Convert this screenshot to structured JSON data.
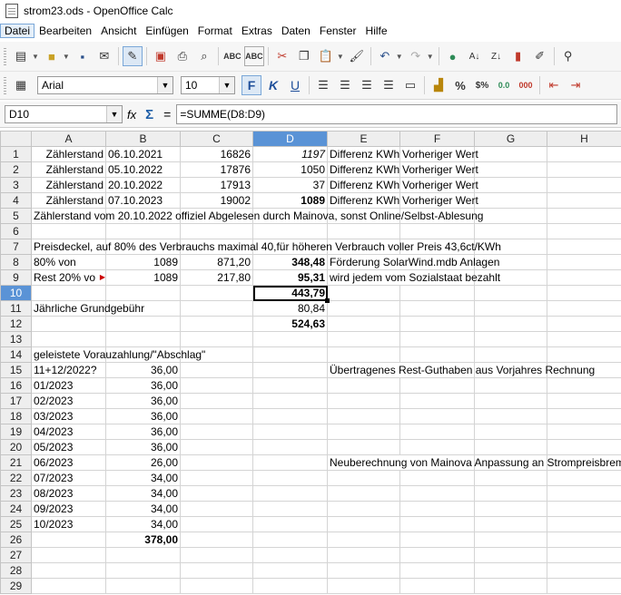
{
  "window": {
    "title": "strom23.ods - OpenOffice Calc"
  },
  "menu": [
    "Datei",
    "Bearbeiten",
    "Ansicht",
    "Einfügen",
    "Format",
    "Extras",
    "Daten",
    "Fenster",
    "Hilfe"
  ],
  "format_toolbar": {
    "font_name": "Arial",
    "font_size": "10",
    "bold_label": "F",
    "italic_label": "K",
    "underline_label": "U",
    "percent_label": "%",
    "decimal_label": "$%",
    "add_decimal_label": "0.0",
    "del_decimal_label": "000"
  },
  "formula_bar": {
    "cell_ref": "D10",
    "fx_label": "fx",
    "sum_label": "Σ",
    "eq_label": "=",
    "formula": "=SUMME(D8:D9)"
  },
  "sheet": {
    "columns": [
      "A",
      "B",
      "C",
      "D",
      "E",
      "F",
      "G",
      "H"
    ],
    "selected_column": "D",
    "selected_row": "10",
    "rows": [
      {
        "n": "1",
        "a": "Zählerstand",
        "b": "06.10.2021",
        "c": "16826",
        "d": "1197",
        "e": "Differenz KWh",
        "f": "Vorheriger Wert"
      },
      {
        "n": "2",
        "a": "Zählerstand",
        "b": "05.10.2022",
        "c": "17876",
        "d": "1050",
        "e": "Differenz KWh",
        "f": "Vorheriger Wert"
      },
      {
        "n": "3",
        "a": "Zählerstand",
        "b": "20.10.2022",
        "c": "17913",
        "d": "37",
        "e": "Differenz KWh",
        "f": "Vorheriger Wert"
      },
      {
        "n": "4",
        "a": "Zählerstand",
        "b": "07.10.2023",
        "c": "19002",
        "d": "1089",
        "e": "Differenz KWh",
        "f": "Vorheriger Wert"
      },
      {
        "n": "5",
        "a": "Zählerstand vom 20.10.2022 offiziel Abgelesen durch Mainova, sonst Online/Selbst-Ablesung"
      },
      {
        "n": "6"
      },
      {
        "n": "7",
        "a": "Preisdeckel, auf 80% des Verbrauchs maximal 40,für höheren Verbrauch voller Preis 43,6ct/KWh"
      },
      {
        "n": "8",
        "a": "80% von",
        "b": "1089",
        "c": "871,20",
        "d": "348,48",
        "ef": "Förderung SolarWind.mdb Anlagen"
      },
      {
        "n": "9",
        "a": "Rest 20% vo",
        "b": "1089",
        "c": "217,80",
        "d": "95,31",
        "ef": "wird jedem vom Sozialstaat bezahlt"
      },
      {
        "n": "10",
        "d": "443,79"
      },
      {
        "n": "11",
        "a": "Jährliche Grundgebühr",
        "d": "80,84"
      },
      {
        "n": "12",
        "d": "524,63"
      },
      {
        "n": "13"
      },
      {
        "n": "14",
        "a": "geleistete Vorauzahlung/\"Abschlag\""
      },
      {
        "n": "15",
        "a": "11+12/2022?",
        "b": "36,00",
        "ef": "Übertragenes Rest-Guthaben aus Vorjahres Rechnung"
      },
      {
        "n": "16",
        "a": "01/2023",
        "b": "36,00"
      },
      {
        "n": "17",
        "a": "02/2023",
        "b": "36,00"
      },
      {
        "n": "18",
        "a": "03/2023",
        "b": "36,00"
      },
      {
        "n": "19",
        "a": "04/2023",
        "b": "36,00"
      },
      {
        "n": "20",
        "a": "05/2023",
        "b": "36,00"
      },
      {
        "n": "21",
        "a": "06/2023",
        "b": "26,00",
        "ef": "Neuberechnung von Mainova Anpassung an Strompreisbremse"
      },
      {
        "n": "22",
        "a": "07/2023",
        "b": "34,00"
      },
      {
        "n": "23",
        "a": "08/2023",
        "b": "34,00"
      },
      {
        "n": "24",
        "a": "09/2023",
        "b": "34,00"
      },
      {
        "n": "25",
        "a": "10/2023",
        "b": "34,00"
      },
      {
        "n": "26",
        "b": "378,00"
      },
      {
        "n": "27"
      },
      {
        "n": "28"
      },
      {
        "n": "29"
      }
    ]
  }
}
